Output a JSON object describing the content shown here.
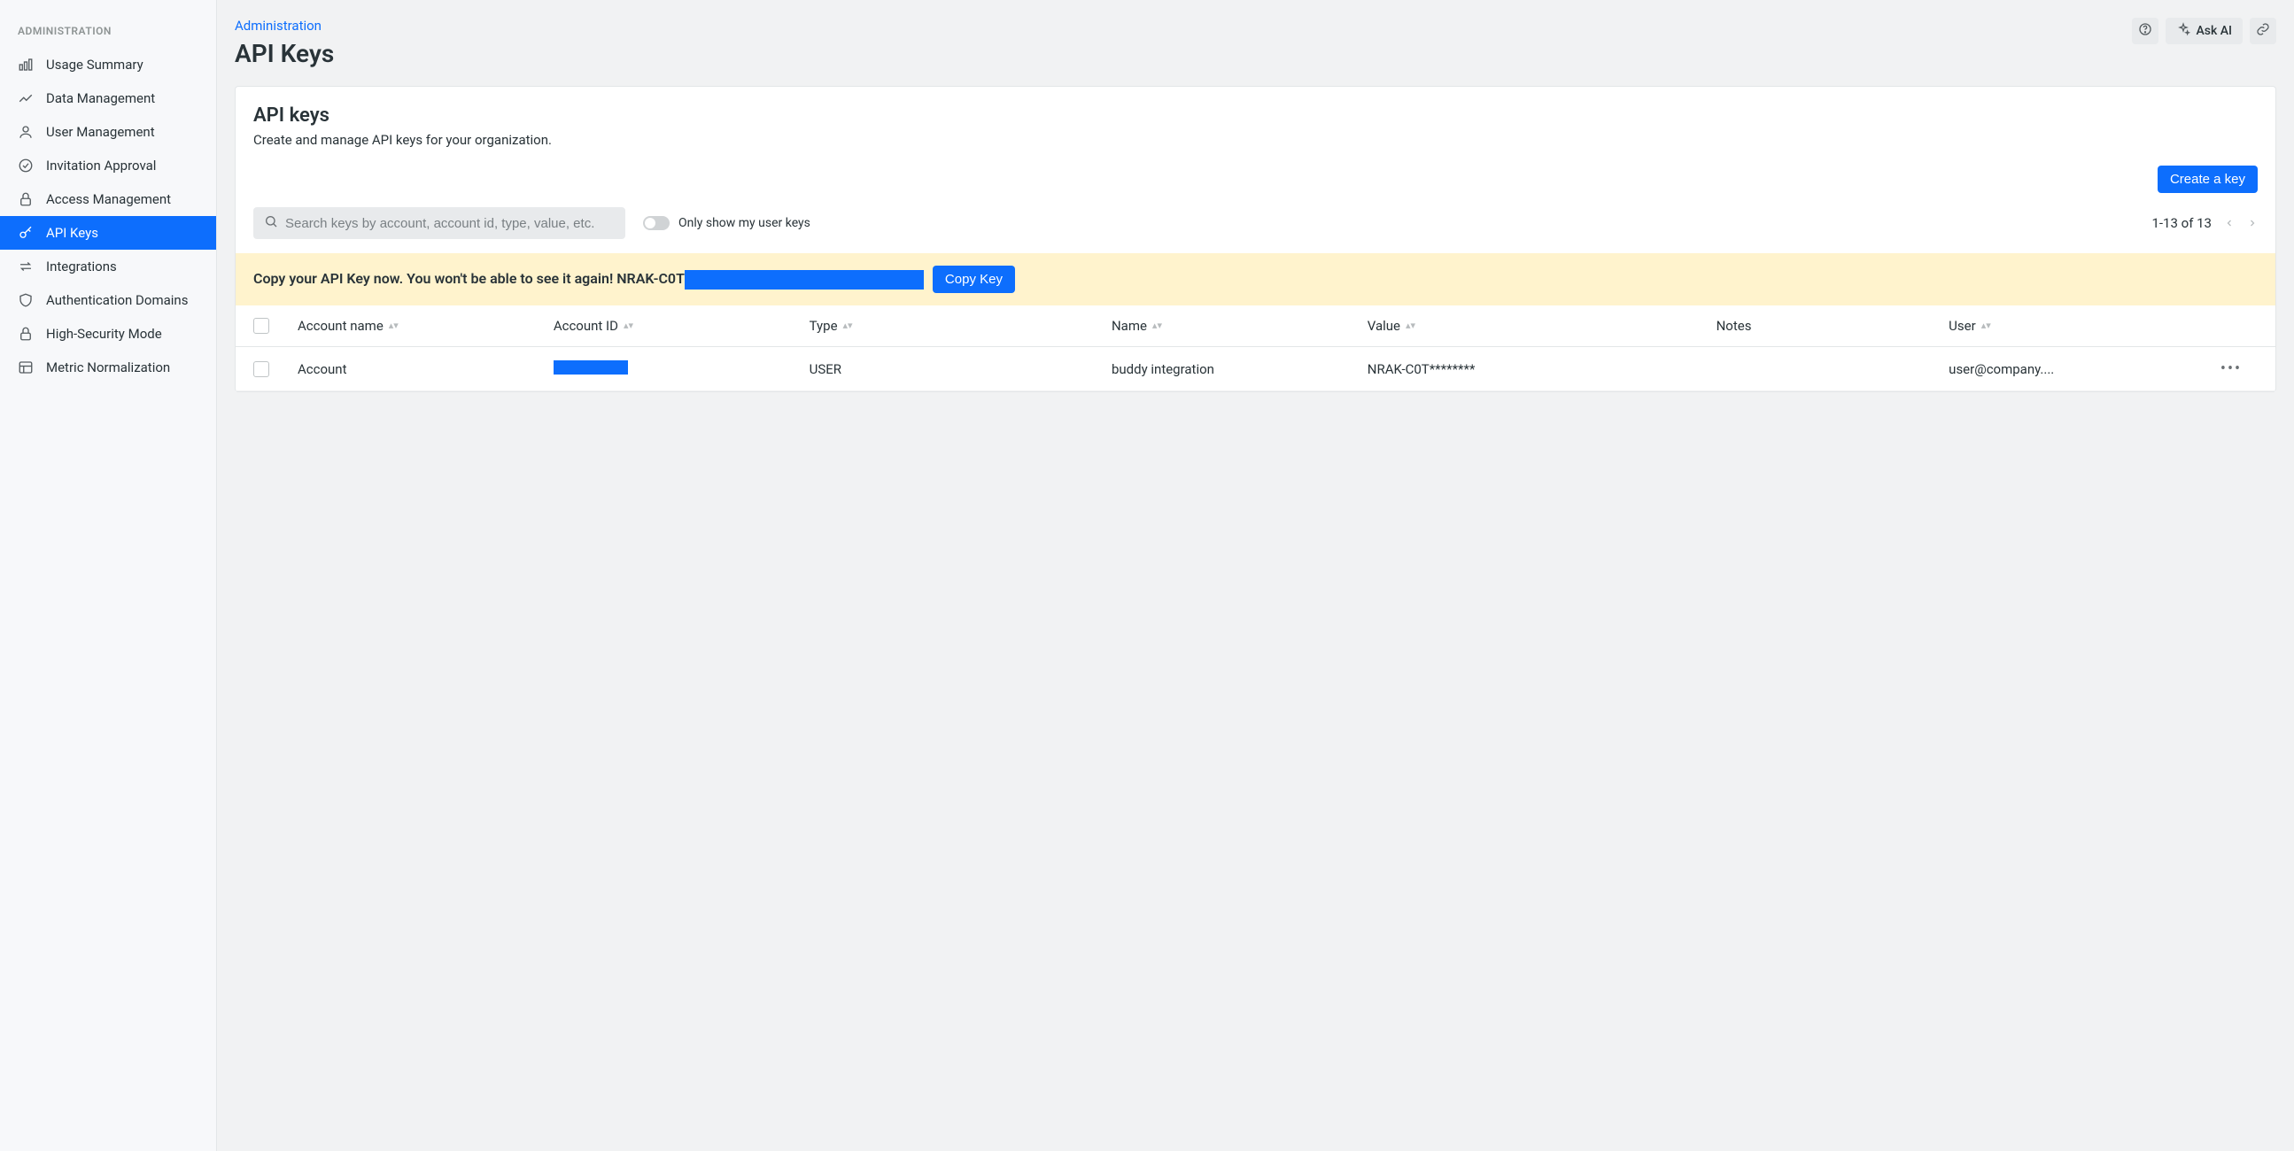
{
  "sidebar": {
    "header": "ADMINISTRATION",
    "items": [
      {
        "label": "Usage Summary",
        "icon": "bar-chart-icon",
        "active": false
      },
      {
        "label": "Data Management",
        "icon": "line-chart-icon",
        "active": false
      },
      {
        "label": "User Management",
        "icon": "user-icon",
        "active": false
      },
      {
        "label": "Invitation Approval",
        "icon": "check-circle-icon",
        "active": false
      },
      {
        "label": "Access Management",
        "icon": "lock-icon",
        "active": false
      },
      {
        "label": "API Keys",
        "icon": "key-icon",
        "active": true
      },
      {
        "label": "Integrations",
        "icon": "swap-icon",
        "active": false
      },
      {
        "label": "Authentication Domains",
        "icon": "shield-icon",
        "active": false
      },
      {
        "label": "High-Security Mode",
        "icon": "lock-icon",
        "active": false
      },
      {
        "label": "Metric Normalization",
        "icon": "layout-icon",
        "active": false
      }
    ]
  },
  "header": {
    "breadcrumb": "Administration",
    "title": "API Keys",
    "ask_ai": "Ask AI"
  },
  "card": {
    "title": "API keys",
    "subtitle": "Create and manage API keys for your organization.",
    "create_button": "Create a key",
    "search_placeholder": "Search keys by account, account id, type, value, etc.",
    "toggle_label": "Only show my user keys",
    "pagination": "1-13 of 13"
  },
  "banner": {
    "prefix": "Copy your API Key now. You won't be able to see it again! NRAK-C0T",
    "copy_button": "Copy Key"
  },
  "table": {
    "columns": [
      "Account name",
      "Account ID",
      "Type",
      "Name",
      "Value",
      "Notes",
      "User"
    ],
    "rows": [
      {
        "account_name": "Account",
        "account_id_redacted": true,
        "type": "USER",
        "name": "buddy integration",
        "value": "NRAK-C0T********",
        "notes": "",
        "user": "user@company...."
      }
    ]
  }
}
